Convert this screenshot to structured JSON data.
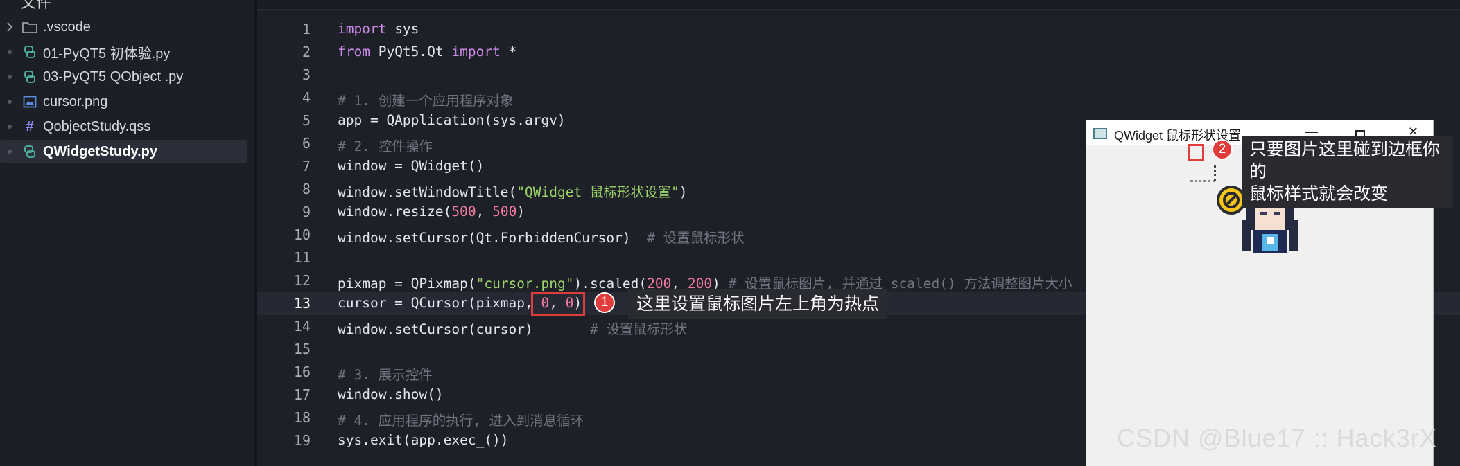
{
  "sidebar": {
    "top_label": "文件",
    "items": [
      {
        "label": ".vscode",
        "icon": "folder-icon",
        "lead": "chevron"
      },
      {
        "label": "01-PyQT5 初体验.py",
        "icon": "python-file-icon",
        "lead": "dot"
      },
      {
        "label": "03-PyQT5 QObject .py",
        "icon": "python-file-icon",
        "lead": "dot"
      },
      {
        "label": "cursor.png",
        "icon": "image-file-icon",
        "lead": "dot"
      },
      {
        "label": "QobjectStudy.qss",
        "icon": "hash-icon",
        "lead": "dot"
      },
      {
        "label": "QWidgetStudy.py",
        "icon": "python-file-icon",
        "lead": "dot",
        "active": true
      }
    ]
  },
  "editor": {
    "current_line": 13,
    "line_numbers": [
      "1",
      "2",
      "3",
      "4",
      "5",
      "6",
      "7",
      "8",
      "9",
      "10",
      "11",
      "12",
      "13",
      "14",
      "15",
      "16",
      "17",
      "18",
      "19"
    ],
    "lines": {
      "l1": [
        "import",
        " sys"
      ],
      "l2": [
        "from",
        " PyQt5.Qt ",
        "import",
        " *"
      ],
      "l4": "# 1. 创建一个应用程序对象",
      "l5": "app = QApplication(sys.argv)",
      "l6": "# 2. 控件操作",
      "l7": "window = QWidget()",
      "l8": [
        "window.setWindowTitle(",
        "\"QWidget 鼠标形状设置\"",
        ")"
      ],
      "l9": [
        "window.resize(",
        "500",
        ", ",
        "500",
        ")"
      ],
      "l10": [
        "window.setCursor(Qt.ForbiddenCursor)  ",
        "# 设置鼠标形状"
      ],
      "l12": [
        "pixmap = QPixmap(",
        "\"cursor.png\"",
        ").scaled(",
        "200",
        ", ",
        "200",
        ") ",
        "# 设置鼠标图片, 并通过 scaled() 方法调整图片大小"
      ],
      "l13": [
        "cursor = QCursor(pixmap, ",
        "0",
        ", ",
        "0",
        ")"
      ],
      "l14": [
        "window.setCursor(cursor)       ",
        "# 设置鼠标形状"
      ],
      "l16": "# 3. 展示控件",
      "l17": "window.show()",
      "l18": "# 4. 应用程序的执行, 进入到消息循环",
      "l19": "sys.exit(app.exec_())"
    }
  },
  "callouts": [
    {
      "number": "1",
      "text": "这里设置鼠标图片左上角为热点"
    },
    {
      "number": "2",
      "text_line1": "只要图片这里碰到边框你的",
      "text_line2": "鼠标样式就会改变"
    }
  ],
  "qt_window": {
    "title": "QWidget 鼠标形状设置",
    "controls": {
      "minimize": "—",
      "maximize": "□",
      "close": "✕"
    }
  },
  "watermark": "CSDN @Blue17 :: Hack3rX",
  "colors": {
    "keyword": "#c98ae6",
    "string": "#9dd46a",
    "number": "#f07aa0",
    "comment": "#6f7480",
    "highlight": "#e03c3c"
  }
}
